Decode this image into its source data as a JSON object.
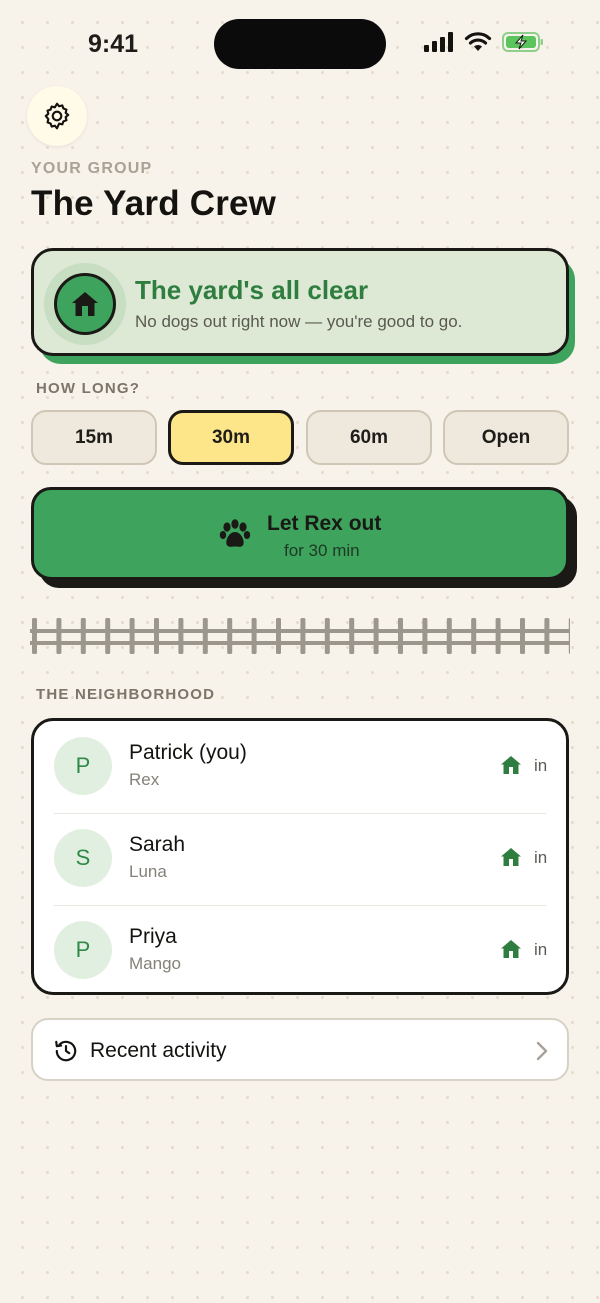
{
  "status_bar": {
    "time": "9:41"
  },
  "header": {
    "group_label": "YOUR GROUP",
    "group_name": "The Yard Crew"
  },
  "yard_status": {
    "title": "The yard's all clear",
    "subtitle": "No dogs out right now — you're good to go.",
    "icon": "house-icon"
  },
  "duration": {
    "label": "HOW LONG?",
    "options": [
      "15m",
      "30m",
      "60m",
      "Open"
    ],
    "selected": "30m"
  },
  "cta": {
    "title": "Let Rex out",
    "subtitle": "for 30 min",
    "icon": "paw-icon"
  },
  "neighborhood": {
    "label": "THE NEIGHBORHOOD",
    "members": [
      {
        "initial": "P",
        "name": "Patrick (you)",
        "pet": "Rex",
        "status": "in"
      },
      {
        "initial": "S",
        "name": "Sarah",
        "pet": "Luna",
        "status": "in"
      },
      {
        "initial": "P",
        "name": "Priya",
        "pet": "Mango",
        "status": "in"
      }
    ]
  },
  "activity": {
    "label": "Recent activity",
    "icon": "history-icon"
  },
  "colors": {
    "background": "#f7f3ea",
    "accent_green": "#3da35d",
    "dark_green": "#2f7d3f",
    "selected_yellow": "#fde58a",
    "ink": "#1a1916"
  }
}
